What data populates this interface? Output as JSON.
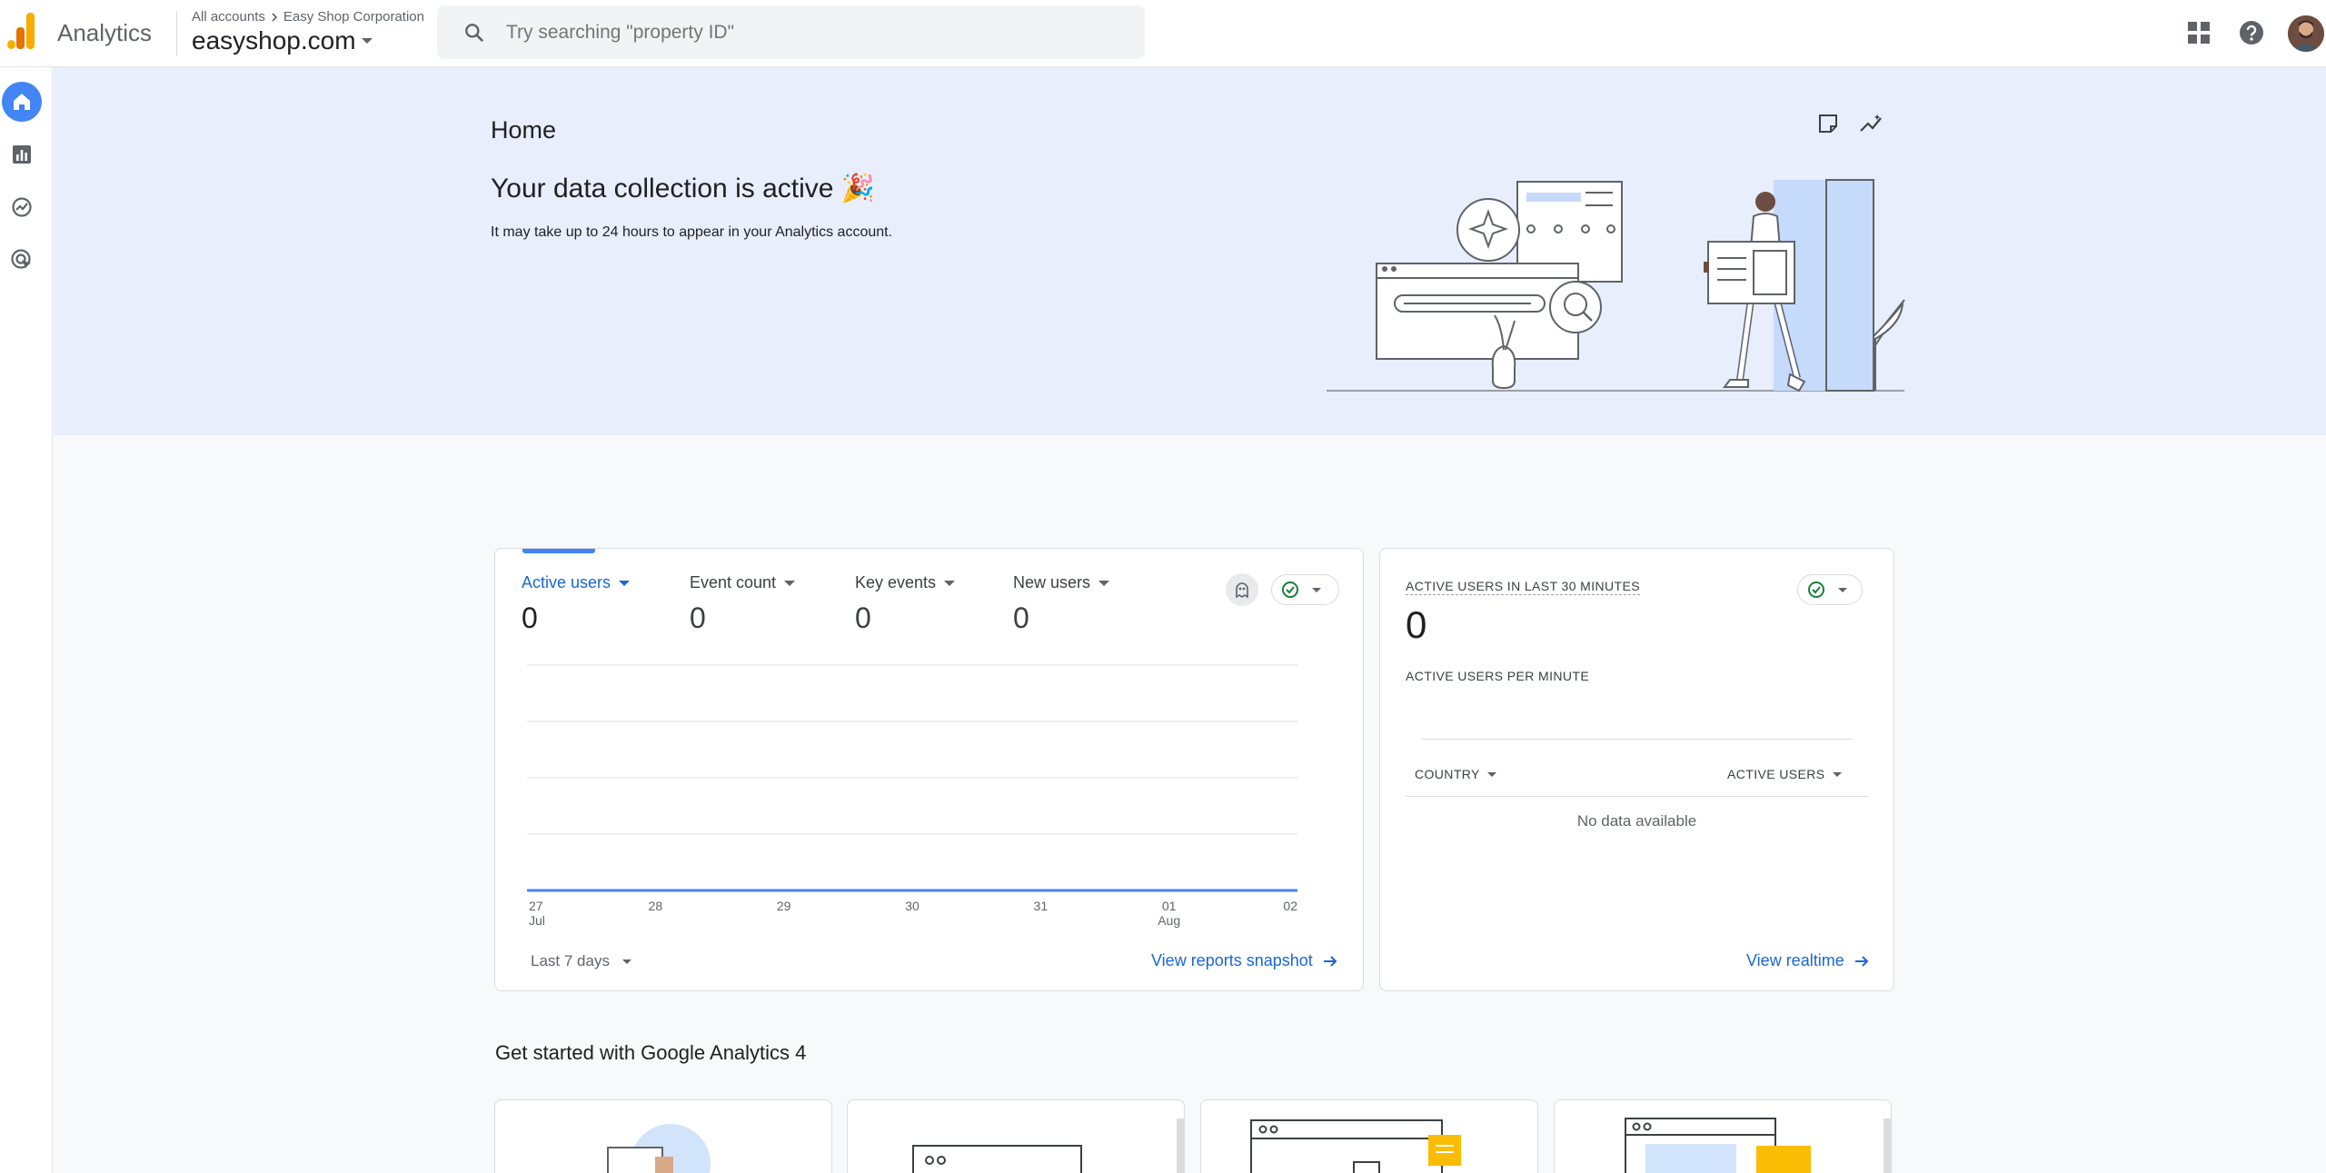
{
  "header": {
    "app_name": "Analytics",
    "breadcrumb_account": "All accounts",
    "breadcrumb_org": "Easy Shop Corporation",
    "property": "easyshop.com",
    "search_placeholder": "Try searching \"property ID\""
  },
  "hero": {
    "page_title": "Home",
    "headline": "Your data collection is active 🎉",
    "subtext": "It may take up to 24 hours to appear in your Analytics account."
  },
  "overview_card": {
    "metrics": [
      {
        "label": "Active users",
        "value": "0"
      },
      {
        "label": "Event count",
        "value": "0"
      },
      {
        "label": "Key events",
        "value": "0"
      },
      {
        "label": "New users",
        "value": "0"
      }
    ],
    "date_range": "Last 7 days",
    "link": "View reports snapshot"
  },
  "realtime_card": {
    "title": "ACTIVE USERS IN LAST 30 MINUTES",
    "value": "0",
    "subtitle": "ACTIVE USERS PER MINUTE",
    "col_country": "COUNTRY",
    "col_active": "ACTIVE USERS",
    "no_data": "No data available",
    "link": "View realtime"
  },
  "get_started": {
    "title": "Get started with Google Analytics 4"
  },
  "chart_data": {
    "type": "line",
    "x": [
      "27 Jul",
      "28",
      "29",
      "30",
      "31",
      "01 Aug",
      "02"
    ],
    "tick_top": [
      "27",
      "28",
      "29",
      "30",
      "31",
      "01",
      "02"
    ],
    "tick_bottom": [
      "Jul",
      "",
      "",
      "",
      "",
      "Aug",
      ""
    ],
    "series": [
      {
        "values": [
          0,
          0,
          0,
          0,
          0,
          0,
          0
        ]
      }
    ],
    "grid": true,
    "color": "#4285f4"
  },
  "colors": {
    "accent": "#1967d2",
    "hero_bg": "#e8eefc",
    "active_nav": "#4285f4",
    "success": "#188038"
  },
  "icons": {
    "left_nav": [
      "home-icon",
      "reports-icon",
      "explore-icon",
      "advertising-icon"
    ],
    "toolbar": [
      "apps-grid-icon",
      "help-icon",
      "avatar"
    ]
  }
}
